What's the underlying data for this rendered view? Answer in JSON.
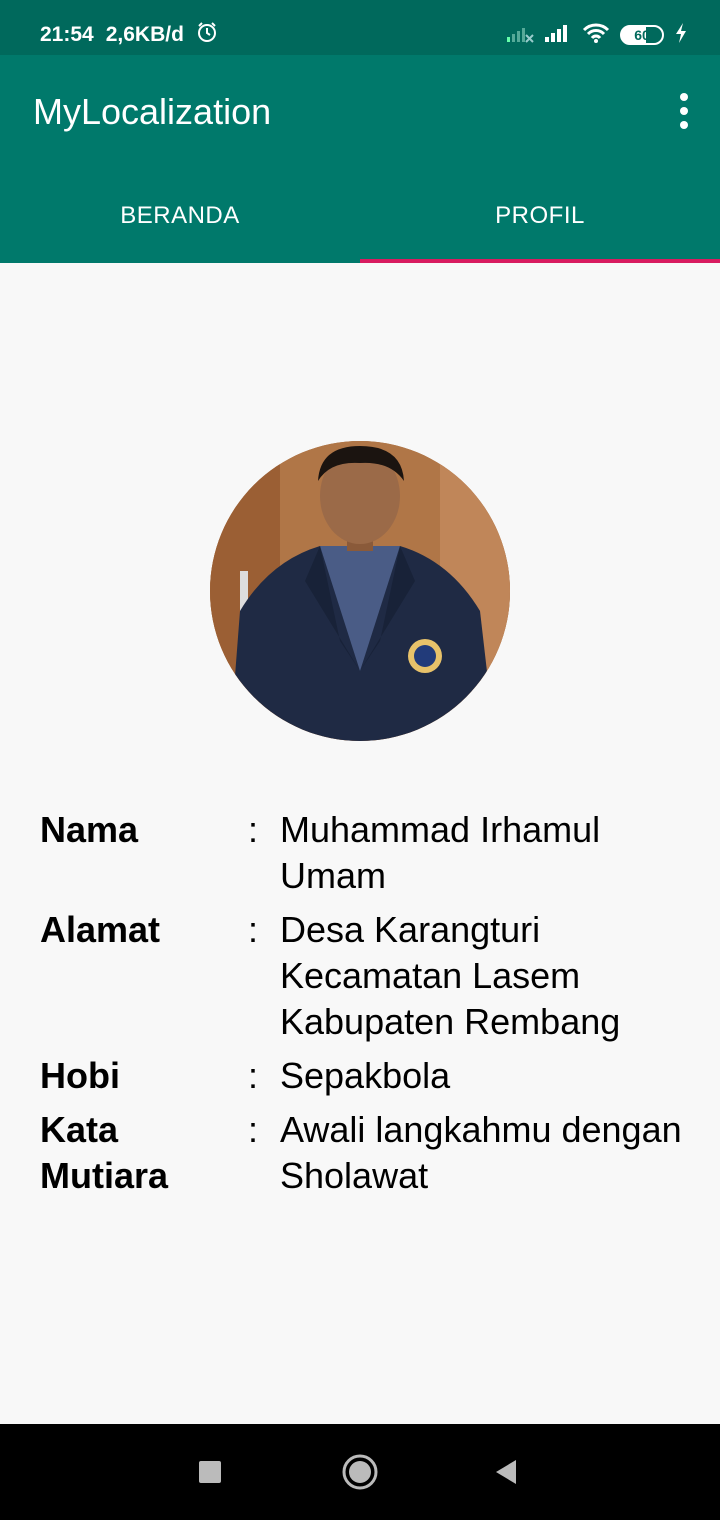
{
  "status": {
    "time": "21:54",
    "speed": "2,6KB/d",
    "battery": "60"
  },
  "app": {
    "title": "MyLocalization"
  },
  "tabs": [
    {
      "label": "BERANDA",
      "active": false
    },
    {
      "label": "PROFIL",
      "active": true
    }
  ],
  "profile": {
    "colon": ":",
    "rows": [
      {
        "label": "Nama",
        "value": "Muhammad Irhamul Umam"
      },
      {
        "label": "Alamat",
        "value": "Desa Karangturi Kecamatan Lasem Kabupaten Rembang"
      },
      {
        "label": "Hobi",
        "value": "Sepakbola"
      },
      {
        "label": "Kata Mutiara",
        "value": "Awali langkahmu dengan Sholawat"
      }
    ]
  },
  "colors": {
    "status_bar": "#00695c",
    "app_bar": "#00796b",
    "tab_indicator": "#d81b60"
  }
}
